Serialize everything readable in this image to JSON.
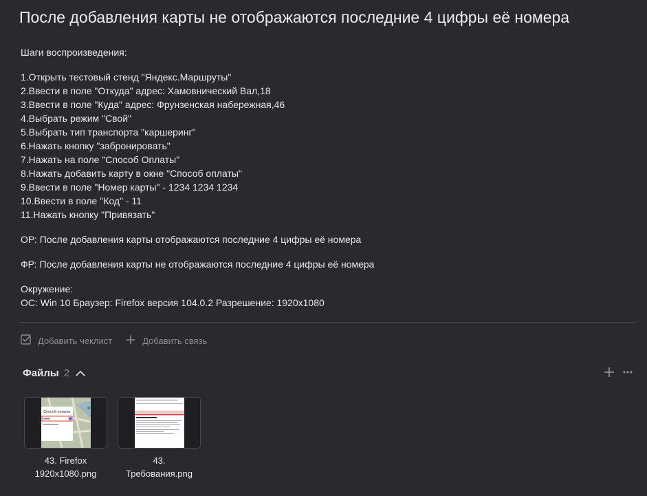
{
  "issue": {
    "title": "После добавления карты не отображаются последние 4 цифры её номера",
    "steps_heading": "Шаги воспроизведения:",
    "steps": [
      "1.Открыть тестовый стенд \"Яндекс.Маршруты\"",
      "2.Ввести в поле \"Откуда\" адрес: Хамовнический Вал,18",
      "3.Ввести в поле \"Куда\" адрес: Фрунзенская набережная,46",
      "4.Выбрать режим \"Свой\"",
      "5.Выбрать тип транспорта \"каршеринг\"",
      "6.Нажать кнопку \"забронировать\"",
      "7.Нажать на поле \"Способ Оплаты\"",
      "8.Нажать добавить карту в окне \"Способ оплаты\"",
      "9.Ввести в поле \"Номер карты\" - 1234 1234 1234",
      "10.Ввести в поле \"Код\" - 11",
      "11.Нажать кнопку \"Привязать\""
    ],
    "expected": "ОР: После добавления карты отображаются последние 4 цифры её номера",
    "actual": "ФР: После добавления карты не отображаются последние 4 цифры её номера",
    "environment_heading": "Окружение:",
    "environment": "ОС: Win 10 Браузер: Firefox версия 104.0.2 Разрешение: 1920x1080"
  },
  "actions": {
    "checklist_label": "Добавить чеклист",
    "link_label": "Добавить связь"
  },
  "files": {
    "title": "Файлы",
    "count": "2",
    "items": [
      {
        "name_line1": "43. Firefox",
        "name_line2": "1920x1080.png"
      },
      {
        "name_line1": "43.",
        "name_line2": "Требования.png"
      }
    ]
  },
  "thumbnails": {
    "first_popup_title": "Способ оплаты"
  },
  "colors": {
    "background": "#29292e",
    "text": "#e8e8ec",
    "muted": "#8c8c94",
    "divider": "#46464d"
  }
}
